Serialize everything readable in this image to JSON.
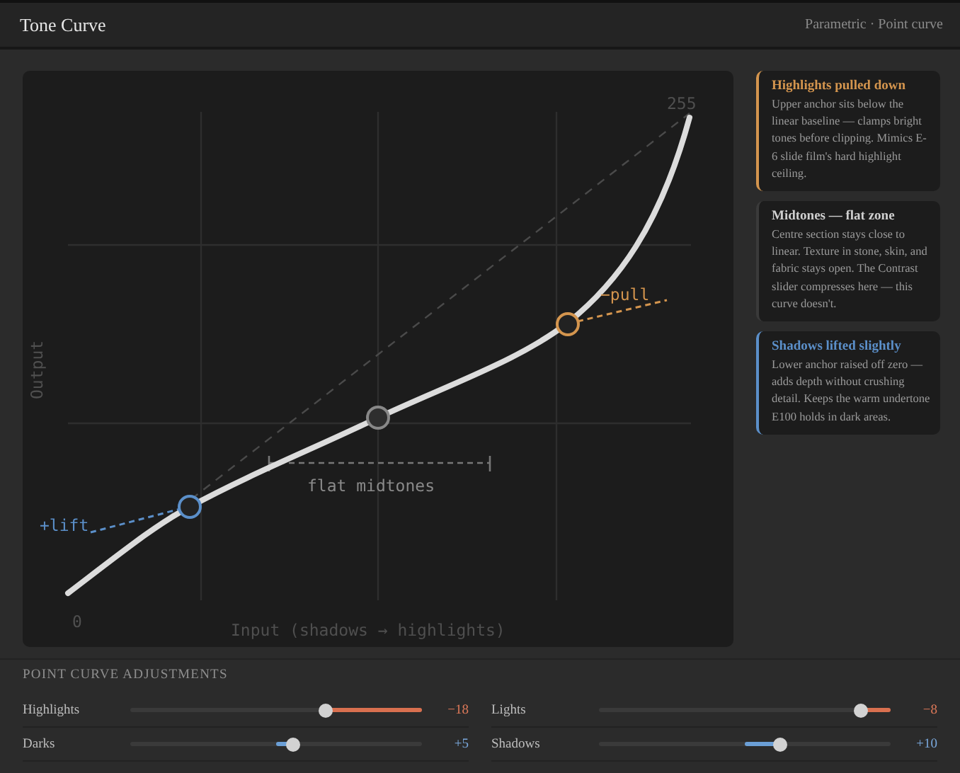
{
  "header": {
    "title": "Tone Curve",
    "mode": "Parametric · Point curve"
  },
  "curve": {
    "max_label": "255",
    "min_label": "0",
    "y_axis_label": "Output",
    "x_axis_label": "Input (shadows → highlights)",
    "zone_label": "flat midtones",
    "anchors": [
      {
        "label": "+lift",
        "color": "#5b8fc9"
      },
      {
        "label": "−pull",
        "color": "#d4954e"
      }
    ]
  },
  "notes": [
    {
      "title": "Highlights pulled down",
      "body": "Upper anchor sits below the linear baseline — clamps bright tones before clipping. Mimics E-6 slide film's hard highlight ceiling.",
      "color": "#d4954e"
    },
    {
      "title": "Midtones — flat zone",
      "body": "Centre section stays close to linear. Texture in stone, skin, and fabric stays open. The Contrast slider compresses here — this curve doesn't."
    },
    {
      "title": "Shadows lifted slightly",
      "body": "Lower anchor raised off zero — adds depth without crushing detail. Keeps the warm undertone E100 holds in dark areas.",
      "color": "#5b8fc9"
    }
  ],
  "adjustments": {
    "title": "POINT CURVE ADJUSTMENTS",
    "sliders": [
      {
        "label": "Highlights",
        "level": 0.67,
        "kind": "cut",
        "reading": "−18"
      },
      {
        "label": "Lights",
        "level": 0.9,
        "kind": "cut",
        "reading": "−8"
      },
      {
        "label": "Darks",
        "level": 0.56,
        "kind": "boost",
        "reading": "+5"
      },
      {
        "label": "Shadows",
        "level": 0.62,
        "kind": "boost",
        "reading": "+10"
      }
    ]
  }
}
